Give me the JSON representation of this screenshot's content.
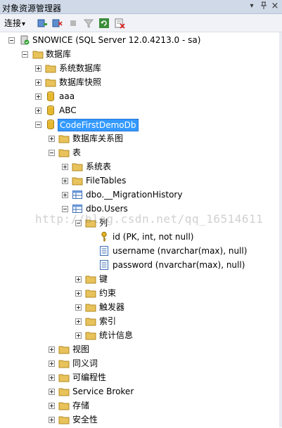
{
  "panel": {
    "title": "对象资源管理器",
    "dropdown_glyph": "▾",
    "pin_glyph": "ᛘ",
    "close_glyph": "×"
  },
  "toolbar": {
    "connect_label": "连接",
    "connect_arrow": "▾"
  },
  "tree": {
    "server": "SNOWICE (SQL Server 12.0.4213.0 - sa)",
    "databases": "数据库",
    "system_databases": "系统数据库",
    "db_snapshots": "数据库快照",
    "db_aaa": "aaa",
    "db_abc": "ABC",
    "db_codefirst": "CodeFirstDemoDb",
    "db_diagrams": "数据库关系图",
    "tables": "表",
    "system_tables": "系统表",
    "filetables": "FileTables",
    "migration_history": "dbo.__MigrationHistory",
    "users_table": "dbo.Users",
    "columns": "列",
    "col_id": "id (PK, int, not null)",
    "col_username": "username (nvarchar(max), null)",
    "col_password": "password (nvarchar(max), null)",
    "keys": "键",
    "constraints": "约束",
    "triggers": "触发器",
    "indexes": "索引",
    "statistics": "统计信息",
    "views": "视图",
    "synonyms": "同义词",
    "programmability": "可编程性",
    "service_broker": "Service Broker",
    "storage": "存储",
    "security": "安全性"
  },
  "watermark": "http://blog.csdn.net/qq_16514611",
  "colors": {
    "selection": "#3399ff",
    "folder": "#e8c25a",
    "titlebar": "#cfd9e8"
  }
}
